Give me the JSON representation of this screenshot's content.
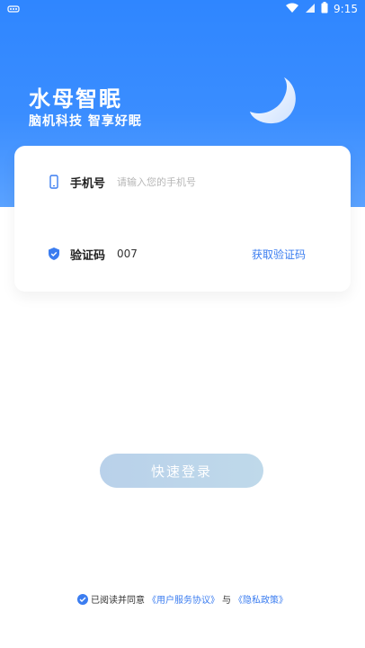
{
  "status": {
    "time": "9:15"
  },
  "hero": {
    "title": "水母智眠",
    "subtitle": "脑机科技 智享好眠"
  },
  "form": {
    "phone_label": "手机号",
    "phone_placeholder": "请输入您的手机号",
    "code_label": "验证码",
    "code_value": "007",
    "get_code": "获取验证码"
  },
  "login": {
    "button_label": "快速登录"
  },
  "agreement": {
    "prefix": "已阅读并同意",
    "terms": "《用户服务协议》",
    "and": "与",
    "privacy": "《隐私政策》"
  },
  "colors": {
    "primary": "#3b7df0",
    "hero_start": "#2f86ff",
    "button_bg": "#bcd4ea"
  }
}
